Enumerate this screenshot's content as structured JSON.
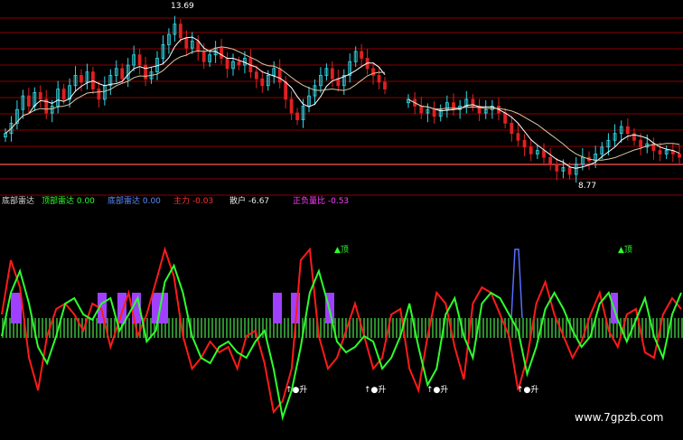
{
  "colors": {
    "background": "#000000",
    "grid": "#8b0000",
    "bar_up": "#33d8e8",
    "bar_down": "#e02020",
    "ma_fast": "#ffffff",
    "ma_slow": "#d8c7a0",
    "baseline": "#ff5a5a",
    "red_line": "#ff1a1a",
    "green_line": "#2dff2d",
    "blue_line": "#5a6cff",
    "purple_block": "#a040ff",
    "stripe_light": "#f5e6b8",
    "stripe_green": "#2e8b2e",
    "marker_text": "#ffffff",
    "marker_green": "#2dff2d"
  },
  "price_labels": {
    "high": "13.69",
    "low": "8.77"
  },
  "indicator_legend": [
    {
      "text": "底部雷达",
      "color": "#d8d8d8"
    },
    {
      "text": "顶部雷达 0.00",
      "color": "#2dff2d"
    },
    {
      "text": "底部雷达 0.00",
      "color": "#5a8cff"
    },
    {
      "text": "主力 -0.03",
      "color": "#ff3030"
    },
    {
      "text": "散户 -6.67",
      "color": "#e7e7e7"
    },
    {
      "text": "正负量比 -0.53",
      "color": "#ff40ff"
    }
  ],
  "markers": {
    "top_label": "▲顶",
    "bottom_label": "↑●升"
  },
  "watermark": "www.7gpzb.com",
  "chart_data": [
    {
      "type": "candlestick",
      "title": "",
      "grid": true,
      "ylim": [
        8.5,
        14.0
      ],
      "series": [
        {
          "name": "",
          "note": "segment A (left), price close series",
          "values": [
            10.2,
            10.5,
            10.9,
            11.3,
            11.0,
            11.4,
            11.2,
            10.8,
            11.0,
            11.5,
            11.2,
            11.6,
            11.9,
            11.7,
            12.0,
            11.5,
            11.2,
            11.6,
            11.9,
            12.1,
            11.8,
            12.2,
            12.5,
            12.2,
            11.8,
            12.0,
            12.4,
            12.8,
            13.1,
            13.4,
            13.0,
            12.7,
            12.9,
            12.6,
            12.3,
            12.5,
            12.7,
            12.4,
            12.1,
            12.3,
            12.2,
            12.4,
            12.0,
            11.8,
            11.6,
            11.9,
            12.1,
            11.7,
            11.2,
            10.8,
            10.6,
            11.0,
            11.3,
            11.6,
            11.9,
            12.1,
            11.8,
            11.6,
            11.9,
            12.3,
            12.6,
            12.4,
            12.1,
            11.9,
            11.7,
            11.5
          ]
        },
        {
          "name": "",
          "note": "segment B (right), price close series",
          "values": [
            11.2,
            11.0,
            10.8,
            10.9,
            10.7,
            10.9,
            11.1,
            10.9,
            11.0,
            11.2,
            11.0,
            10.8,
            10.9,
            11.0,
            10.8,
            10.5,
            10.2,
            10.0,
            9.8,
            9.6,
            9.7,
            9.5,
            9.3,
            9.1,
            9.2,
            9.0,
            9.3,
            9.5,
            9.4,
            9.6,
            9.8,
            10.0,
            10.2,
            10.4,
            10.2,
            10.0,
            9.8,
            9.9,
            9.7,
            9.6,
            9.7,
            9.6,
            9.5
          ]
        }
      ]
    },
    {
      "type": "line",
      "title": "",
      "grid": false,
      "ylim": [
        -100,
        100
      ],
      "series": [
        {
          "name": "",
          "values": [
            10,
            60,
            35,
            -30,
            -60,
            -10,
            15,
            20,
            10,
            -5,
            20,
            15,
            -20,
            5,
            30,
            -10,
            10,
            40,
            70,
            45,
            -10,
            -40,
            -30,
            -15,
            -25,
            -20,
            -40,
            -10,
            -5,
            -35,
            -80,
            -70,
            -40,
            60,
            70,
            -10,
            -40,
            -30,
            -5,
            20,
            -10,
            -40,
            -30,
            10,
            15,
            -40,
            -60,
            -10,
            30,
            20,
            -20,
            -50,
            20,
            35,
            30,
            10,
            -10,
            -60,
            -30,
            20,
            40,
            10,
            -10,
            -30,
            -15,
            10,
            30,
            -5,
            -20,
            10,
            15,
            -25,
            -30,
            10,
            25,
            15
          ]
        },
        {
          "name": "",
          "values": [
            -10,
            30,
            50,
            20,
            -20,
            -35,
            -10,
            20,
            25,
            10,
            5,
            20,
            25,
            -5,
            10,
            25,
            -15,
            -5,
            40,
            55,
            30,
            -10,
            -30,
            -35,
            -20,
            -15,
            -25,
            -30,
            -15,
            -5,
            -40,
            -85,
            -60,
            -20,
            30,
            50,
            20,
            -15,
            -25,
            -20,
            -10,
            -15,
            -40,
            -30,
            -10,
            20,
            -20,
            -55,
            -40,
            10,
            25,
            -10,
            -30,
            20,
            30,
            25,
            10,
            -5,
            -45,
            -20,
            15,
            30,
            15,
            -5,
            -20,
            -10,
            20,
            30,
            5,
            -15,
            5,
            25,
            -10,
            -30,
            10,
            30
          ]
        }
      ]
    }
  ]
}
